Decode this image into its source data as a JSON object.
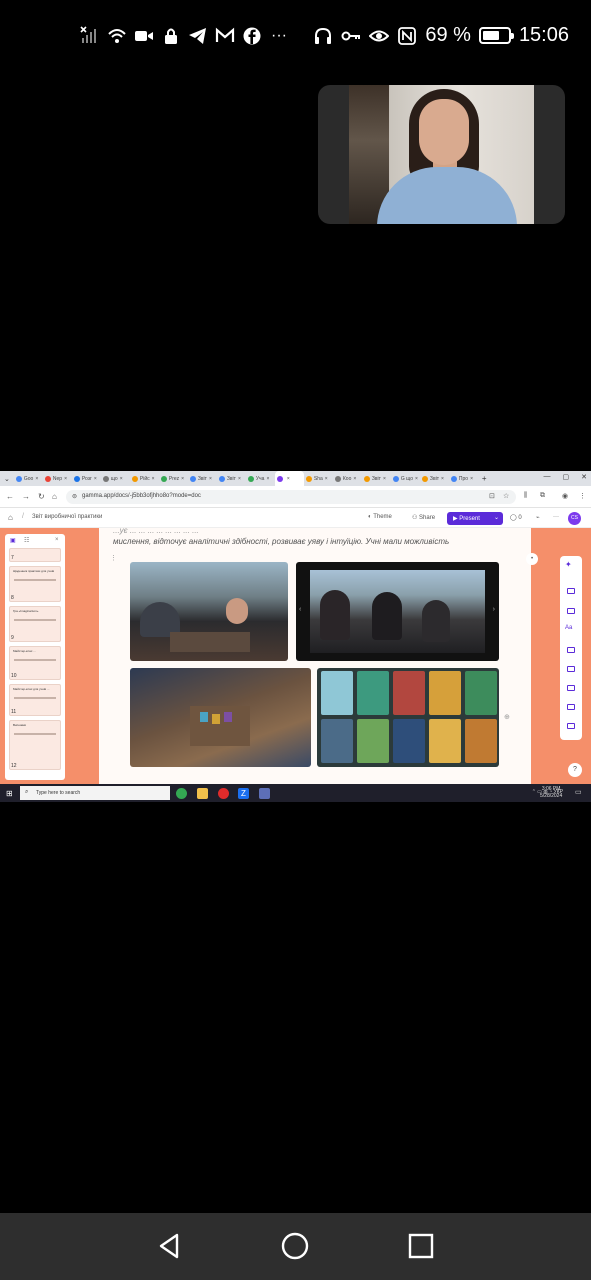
{
  "status_bar": {
    "battery_percent": "69 %",
    "battery_level": 0.69,
    "time": "15:06",
    "more_indicator": "···",
    "left_icons": [
      "signal-off-icon",
      "wifi-icon",
      "video-call-icon",
      "lock-icon",
      "telegram-icon",
      "gmail-icon",
      "facebook-icon"
    ],
    "right_icons": [
      "headphones-icon",
      "key-icon",
      "eye-icon",
      "nfc-icon"
    ]
  },
  "shared_screen": {
    "tabs": [
      {
        "label": "Goo",
        "color": "#4285f4"
      },
      {
        "label": "Nep",
        "color": "#e94235"
      },
      {
        "label": "Розг",
        "color": "#1a73e8"
      },
      {
        "label": "що",
        "color": "#777"
      },
      {
        "label": "Рійс",
        "color": "#f29900"
      },
      {
        "label": "Prez",
        "color": "#34a853"
      },
      {
        "label": "Звіт",
        "color": "#4285f4"
      },
      {
        "label": "Звіт",
        "color": "#4285f4"
      },
      {
        "label": "Уча",
        "color": "#34a853"
      },
      {
        "label": "",
        "color": "#7c3aed",
        "active": true
      },
      {
        "label": "Sha",
        "color": "#f29900"
      },
      {
        "label": "Коо",
        "color": "#777"
      },
      {
        "label": "Звіт",
        "color": "#f29900"
      },
      {
        "label": "G що",
        "color": "#4285f4"
      },
      {
        "label": "Звіт",
        "color": "#f29900"
      },
      {
        "label": "Про",
        "color": "#4285f4"
      }
    ],
    "new_tab": "+",
    "url": "gamma.app/docs/-j5bb3ofjhho8o?mode=doc",
    "doc_title": "Звіт виробничої практики",
    "header": {
      "theme_label": "Theme",
      "share_label": "Share",
      "present_label": "Present",
      "comments_count": "0",
      "avatar_initials": "CS"
    },
    "doc_text_line1": "...ує ... ... ... ... ... ... ... ...",
    "doc_text_line2": "мислення, відточує аналітичні здібності, розвиває уяву і інтуїцію. Учні мали можливість",
    "thumbnails": [
      {
        "num": "7"
      },
      {
        "num": "8",
        "title": "Щоденник практики для учнів"
      },
      {
        "num": "9",
        "title": "Гра «Imaginarium»"
      },
      {
        "num": "10",
        "title": "Майстер-клас ..."
      },
      {
        "num": "11",
        "title": "Майстер-клас для учнів ..."
      },
      {
        "num": "12",
        "title": "Висновки"
      }
    ],
    "taskbar": {
      "search_placeholder": "Type here to search",
      "tray": "УКР",
      "time": "3:06 PM",
      "date": "5/28/2024"
    }
  },
  "nav_bar": {
    "buttons": [
      "back",
      "home",
      "recents"
    ]
  }
}
